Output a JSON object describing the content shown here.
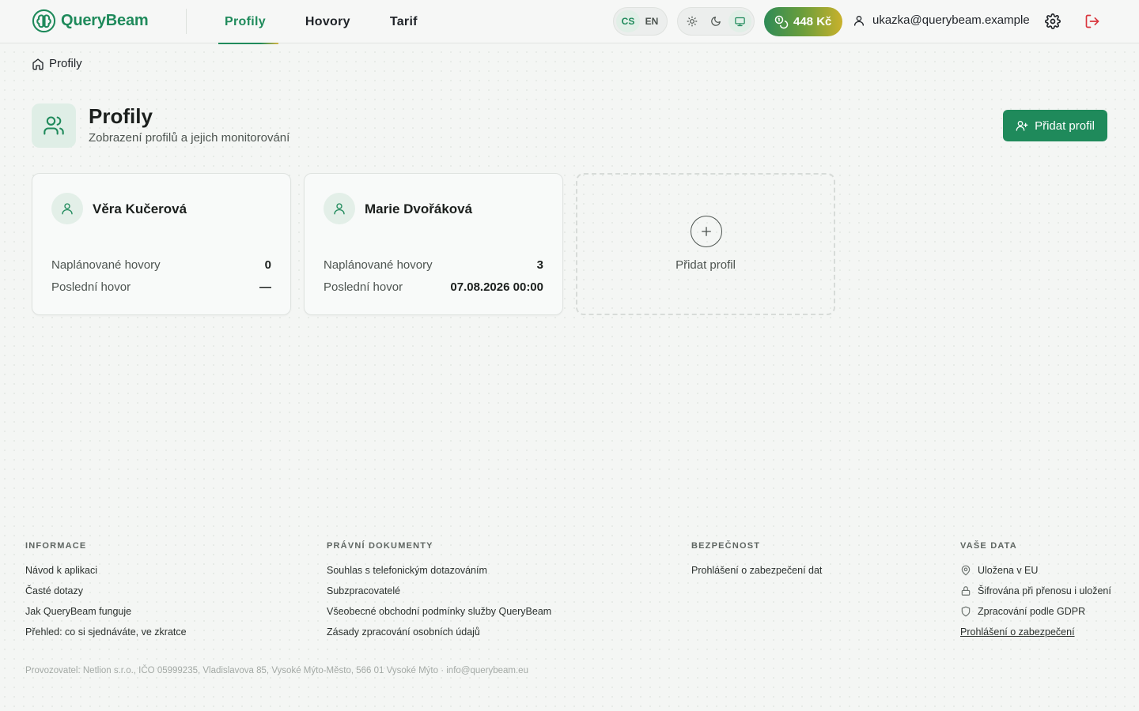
{
  "header": {
    "brand": "QueryBeam",
    "nav": [
      {
        "label": "Profily",
        "active": true
      },
      {
        "label": "Hovory",
        "active": false
      },
      {
        "label": "Tarif",
        "active": false
      }
    ],
    "languages": [
      {
        "label": "CS",
        "active": true
      },
      {
        "label": "EN",
        "active": false
      }
    ],
    "theme_options": [
      {
        "icon": "sun-icon",
        "active": false
      },
      {
        "icon": "moon-icon",
        "active": false
      },
      {
        "icon": "monitor-icon",
        "active": true
      }
    ],
    "credit": "448 Kč",
    "user_email": "ukazka@querybeam.example"
  },
  "breadcrumb": {
    "label": "Profily"
  },
  "page": {
    "title": "Profily",
    "subtitle": "Zobrazení profilů a jejich monitorování",
    "add_button": "Přidat profil"
  },
  "profiles": [
    {
      "name": "Věra Kučerová",
      "scheduled_label": "Naplánované hovory",
      "scheduled_value": "0",
      "last_label": "Poslední hovor",
      "last_value": "—"
    },
    {
      "name": "Marie Dvořáková",
      "scheduled_label": "Naplánované hovory",
      "scheduled_value": "3",
      "last_label": "Poslední hovor",
      "last_value": "07.08.2026 00:00"
    }
  ],
  "add_card": {
    "label": "Přidat profil"
  },
  "footer": {
    "info": {
      "heading": "INFORMACE",
      "links": [
        "Návod k aplikaci",
        "Časté dotazy",
        "Jak QueryBeam funguje",
        "Přehled: co si sjednáváte, ve zkratce"
      ]
    },
    "legal": {
      "heading": "PRÁVNÍ DOKUMENTY",
      "links": [
        "Souhlas s telefonickým dotazováním",
        "Subzpracovatelé",
        "Všeobecné obchodní podmínky služby QueryBeam",
        "Zásady zpracování osobních údajů"
      ]
    },
    "security": {
      "heading": "BEZPEČNOST",
      "links": [
        "Prohlášení o zabezpečení dat"
      ]
    },
    "data": {
      "heading": "VAŠE DATA",
      "items": [
        {
          "icon": "map-pin-icon",
          "label": "Uložena v EU"
        },
        {
          "icon": "lock-icon",
          "label": "Šifrována při přenosu i uložení"
        },
        {
          "icon": "shield-icon",
          "label": "Zpracování podle GDPR"
        }
      ],
      "link": "Prohlášení o zabezpečení"
    },
    "operator": "Provozovatel: Netlion s.r.o., IČO 05999235, Vladislavova 85, Vysoké Mýto-Město, 566 01 Vysoké Mýto · info@querybeam.eu"
  },
  "colors": {
    "brand": "#1f8a5b",
    "danger": "#d9363e",
    "credit_gradient_start": "#2e8b57",
    "credit_gradient_end": "#c9b12c"
  }
}
